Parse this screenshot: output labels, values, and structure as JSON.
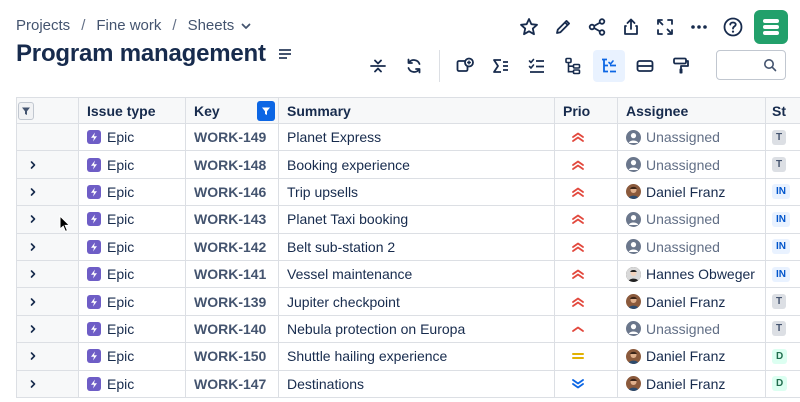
{
  "breadcrumb": [
    "Projects",
    "Fine work",
    "Sheets"
  ],
  "page_title": "Program management",
  "search": {
    "placeholder": "",
    "value": ""
  },
  "columns": {
    "issue_type": "Issue type",
    "key": "Key",
    "summary": "Summary",
    "prio": "Prio",
    "assignee": "Assignee",
    "status": "St"
  },
  "rows": [
    {
      "has_children": false,
      "type": "Epic",
      "key": "WORK-149",
      "summary": "Planet Express",
      "priority": "high",
      "assignee": "Unassigned",
      "assignee_kind": "unassigned",
      "status": "T",
      "status_kind": "todo"
    },
    {
      "has_children": true,
      "type": "Epic",
      "key": "WORK-148",
      "summary": "Booking experience",
      "priority": "high",
      "assignee": "Unassigned",
      "assignee_kind": "unassigned",
      "status": "T",
      "status_kind": "todo"
    },
    {
      "has_children": true,
      "type": "Epic",
      "key": "WORK-146",
      "summary": "Trip upsells",
      "priority": "high",
      "assignee": "Daniel Franz",
      "assignee_kind": "daniel",
      "status": "IN",
      "status_kind": "inprog"
    },
    {
      "has_children": true,
      "type": "Epic",
      "key": "WORK-143",
      "summary": "Planet Taxi booking",
      "priority": "high",
      "assignee": "Unassigned",
      "assignee_kind": "unassigned",
      "status": "IN",
      "status_kind": "inprog"
    },
    {
      "has_children": true,
      "type": "Epic",
      "key": "WORK-142",
      "summary": "Belt sub-station 2",
      "priority": "high",
      "assignee": "Unassigned",
      "assignee_kind": "unassigned",
      "status": "IN",
      "status_kind": "inprog"
    },
    {
      "has_children": true,
      "type": "Epic",
      "key": "WORK-141",
      "summary": "Vessel maintenance",
      "priority": "high",
      "assignee": "Hannes Obweger",
      "assignee_kind": "hannes",
      "status": "IN",
      "status_kind": "inprog"
    },
    {
      "has_children": true,
      "type": "Epic",
      "key": "WORK-139",
      "summary": "Jupiter checkpoint",
      "priority": "high",
      "assignee": "Daniel Franz",
      "assignee_kind": "daniel",
      "status": "T",
      "status_kind": "todo"
    },
    {
      "has_children": true,
      "type": "Epic",
      "key": "WORK-140",
      "summary": "Nebula protection on Europa",
      "priority": "medium-high",
      "assignee": "Unassigned",
      "assignee_kind": "unassigned",
      "status": "T",
      "status_kind": "todo"
    },
    {
      "has_children": true,
      "type": "Epic",
      "key": "WORK-150",
      "summary": "Shuttle hailing experience",
      "priority": "medium",
      "assignee": "Daniel Franz",
      "assignee_kind": "daniel",
      "status": "D",
      "status_kind": "done"
    },
    {
      "has_children": true,
      "type": "Epic",
      "key": "WORK-147",
      "summary": "Destinations",
      "priority": "low",
      "assignee": "Daniel Franz",
      "assignee_kind": "daniel",
      "status": "D",
      "status_kind": "done"
    }
  ],
  "colors": {
    "brand": "#22a06b",
    "accent": "#0c66e4",
    "epic": "#6e5dc6",
    "priority_high": "#e2483d",
    "priority_medium": "#e2b203",
    "priority_low": "#0c66e4"
  },
  "icons": {
    "top_actions": [
      "star-icon",
      "edit-icon",
      "share-icon",
      "export-icon",
      "fullscreen-icon",
      "more-icon",
      "help-icon"
    ],
    "toolbar": [
      "row-height-icon",
      "refresh-icon",
      "add-field-icon",
      "sum-icon",
      "checklist-icon",
      "hierarchy-icon",
      "structure-icon",
      "card-icon",
      "format-painter-icon"
    ]
  }
}
